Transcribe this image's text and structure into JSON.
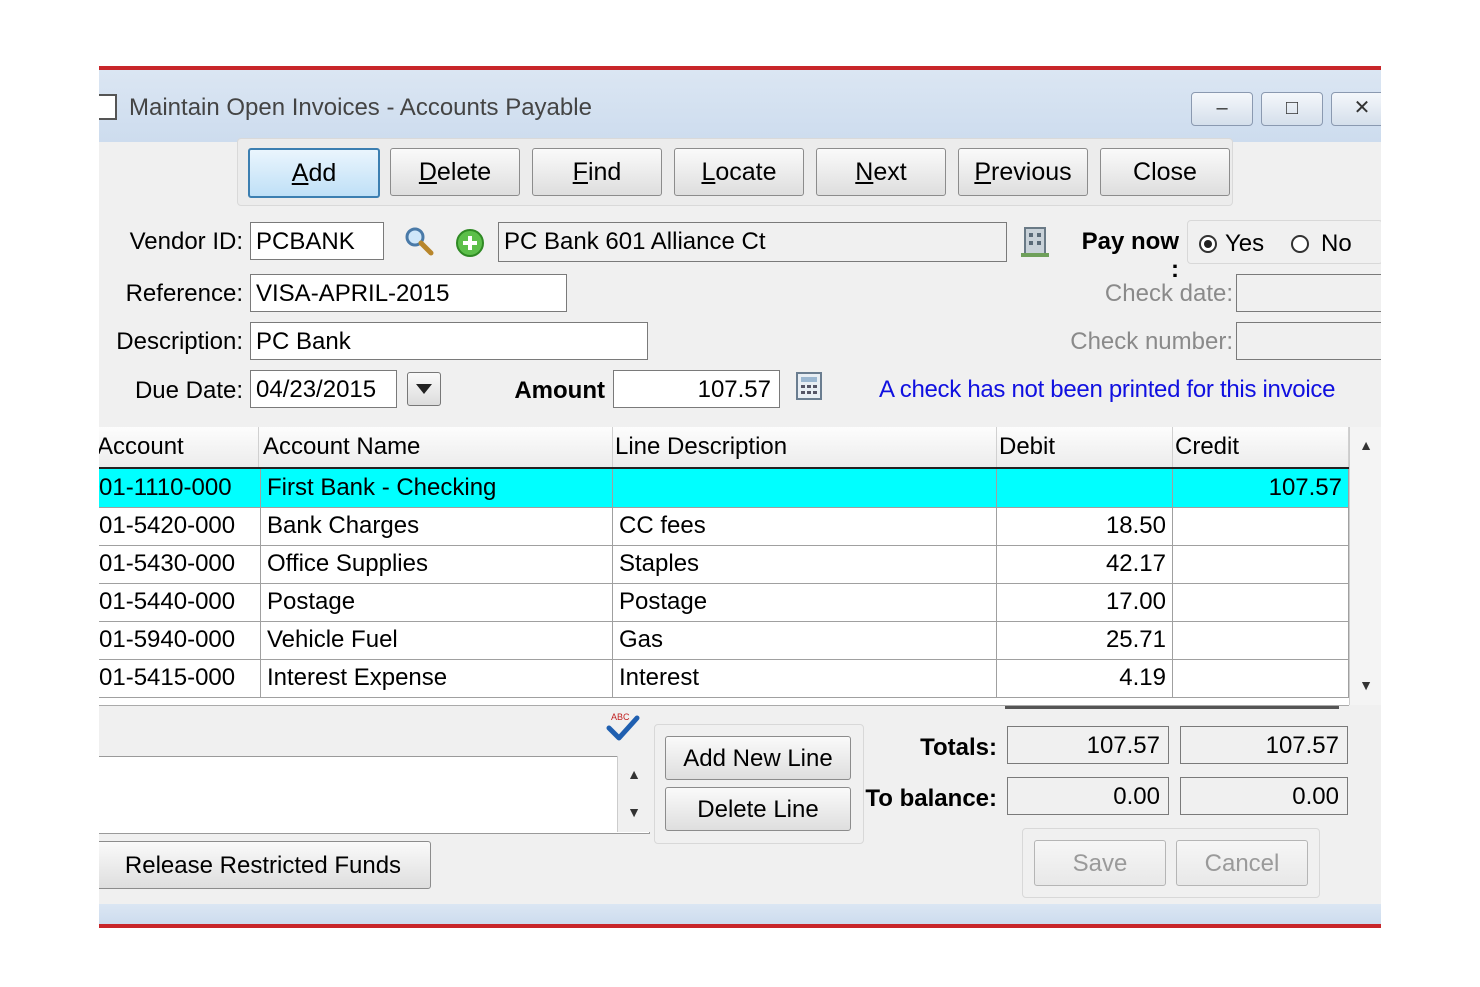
{
  "window": {
    "title": "Maintain Open Invoices - Accounts Payable",
    "controls": {
      "minimize": "–",
      "maximize": "□",
      "close": "✕"
    }
  },
  "toolbar": {
    "buttons": [
      {
        "label": "Add",
        "mnemonic": "A"
      },
      {
        "label": "Delete",
        "mnemonic": "D"
      },
      {
        "label": "Find",
        "mnemonic": "F"
      },
      {
        "label": "Locate",
        "mnemonic": "L"
      },
      {
        "label": "Next",
        "mnemonic": "N"
      },
      {
        "label": "Previous",
        "mnemonic": "P"
      },
      {
        "label": "Close",
        "mnemonic": ""
      }
    ]
  },
  "form": {
    "vendor_id_label": "Vendor ID:",
    "vendor_id": "PCBANK",
    "vendor_name": "PC Bank     601 Alliance Ct",
    "reference_label": "Reference:",
    "reference": "VISA-APRIL-2015",
    "description_label": "Description:",
    "description": "PC Bank",
    "due_date_label": "Due Date:",
    "due_date": "04/23/2015",
    "amount_label": "Amount",
    "amount": "107.57",
    "pay_now_label": "Pay now :",
    "pay_now_yes": "Yes",
    "pay_now_no": "No",
    "pay_now_selected": "Yes",
    "check_date_label": "Check date:",
    "check_date": "",
    "check_number_label": "Check number:",
    "check_number": "",
    "notice": "A check has not been printed for this invoice"
  },
  "grid": {
    "columns": [
      "Account",
      "Account Name",
      "Line Description",
      "Debit",
      "Credit"
    ],
    "rows": [
      {
        "account": "01-1110-000",
        "name": "First Bank - Checking",
        "desc": "",
        "debit": "",
        "credit": "107.57",
        "selected": true
      },
      {
        "account": "01-5420-000",
        "name": "Bank Charges",
        "desc": "CC fees",
        "debit": "18.50",
        "credit": ""
      },
      {
        "account": "01-5430-000",
        "name": "Office Supplies",
        "desc": "Staples",
        "debit": "42.17",
        "credit": ""
      },
      {
        "account": "01-5440-000",
        "name": "Postage",
        "desc": "Postage",
        "debit": "17.00",
        "credit": ""
      },
      {
        "account": "01-5940-000",
        "name": "Vehicle Fuel",
        "desc": "Gas",
        "debit": "25.71",
        "credit": ""
      },
      {
        "account": "01-5415-000",
        "name": "Interest Expense",
        "desc": "Interest",
        "debit": "4.19",
        "credit": ""
      }
    ]
  },
  "footer": {
    "add_new_line": "Add New Line",
    "delete_line": "Delete Line",
    "totals_label": "Totals:",
    "totals_debit": "107.57",
    "totals_credit": "107.57",
    "balance_label": "To balance:",
    "balance_debit": "0.00",
    "balance_credit": "0.00",
    "save": "Save",
    "cancel": "Cancel",
    "release_funds": "Release Restricted Funds"
  },
  "colors": {
    "selected_row": "#00ffff",
    "notice_text": "#1010e0",
    "window_border": "#c8262a"
  }
}
